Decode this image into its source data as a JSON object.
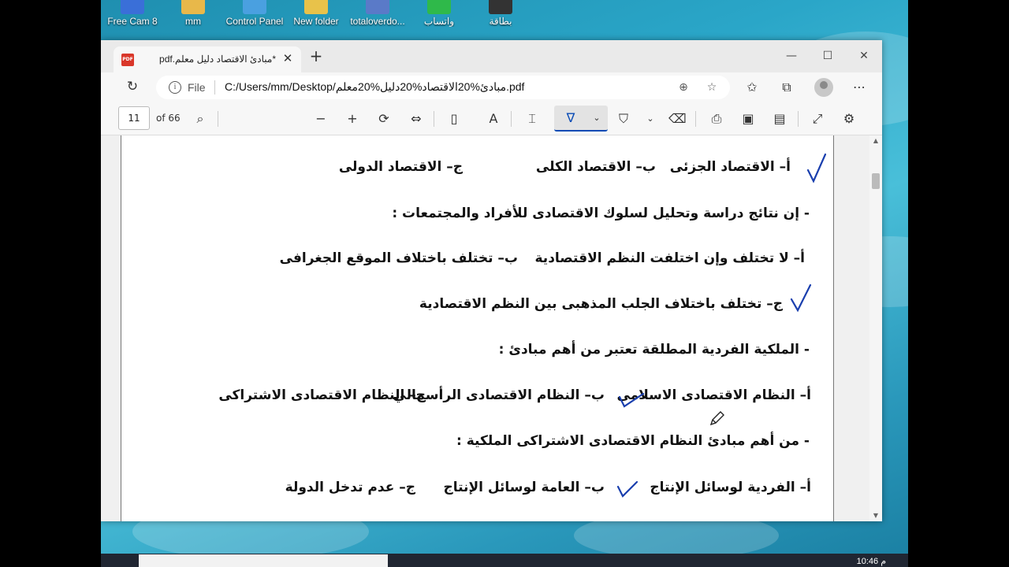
{
  "desktop": {
    "icons": [
      {
        "label": "Free Cam 8",
        "color": "#3a6fd8"
      },
      {
        "label": "mm",
        "color": "#e8b84a"
      },
      {
        "label": "Control Panel",
        "color": "#4aa0e0"
      },
      {
        "label": "New folder",
        "color": "#e8c24a"
      },
      {
        "label": "totaloverdo...",
        "color": "#5a7ac8"
      },
      {
        "label": "واتساب",
        "color": "#2fb94a"
      },
      {
        "label": "بطاقة",
        "color": "#333333"
      }
    ]
  },
  "browser": {
    "tab": {
      "title": "*مبادئ الاقتصاد دليل معلم.pdf",
      "close_icon": "close-icon"
    },
    "new_tab_icon": "plus-icon",
    "window_controls": {
      "minimize": "—",
      "maximize": "☐",
      "close": "✕"
    },
    "address": {
      "scheme": "File",
      "url": "C:/Users/mm/Desktop/مبادئ%20الاقتصاد%20دليل%20معلم.pdf"
    }
  },
  "pdf_toolbar": {
    "page_number": "11",
    "page_count": "of 66"
  },
  "document": {
    "lines": [
      {
        "segments": [
          "أ– الاقتصاد الجزئى",
          "ب– الاقتصاد الكلى",
          "ج– الاقتصاد الدولى"
        ]
      },
      {
        "text": "- إن نتائج دراسة وتحليل لسلوك الاقتصادى للأفراد والمجتمعات :"
      },
      {
        "segments": [
          "أ– لا تختلف وإن اختلفت النظم الاقتصادية",
          "ب– تختلف باختلاف الموقع الجغرافى"
        ]
      },
      {
        "text": "ج– تختلف باختلاف الجلب المذهبى بين النظم الاقتصادية"
      },
      {
        "text": "- الملكية الفردية المطلقة تعتبر من أهم مبادئ :"
      },
      {
        "segments": [
          "أ– النظام الاقتصادى الاسلامى",
          "ب– النظام الاقتصادى الرأسمالي",
          "ج– النظام الاقتصادى الاشتراكى"
        ]
      },
      {
        "text": "- من أهم مبادئ النظام الاقتصادى الاشتراكى الملكية :"
      },
      {
        "segments": [
          "أ– الفردية لوسائل الإنتاج",
          "ب– العامة لوسائل الإنتاج",
          "ج– عدم تدخل الدولة"
        ]
      }
    ],
    "ink_color": "#1a3fae"
  },
  "taskbar": {
    "time": "10:46 م"
  }
}
